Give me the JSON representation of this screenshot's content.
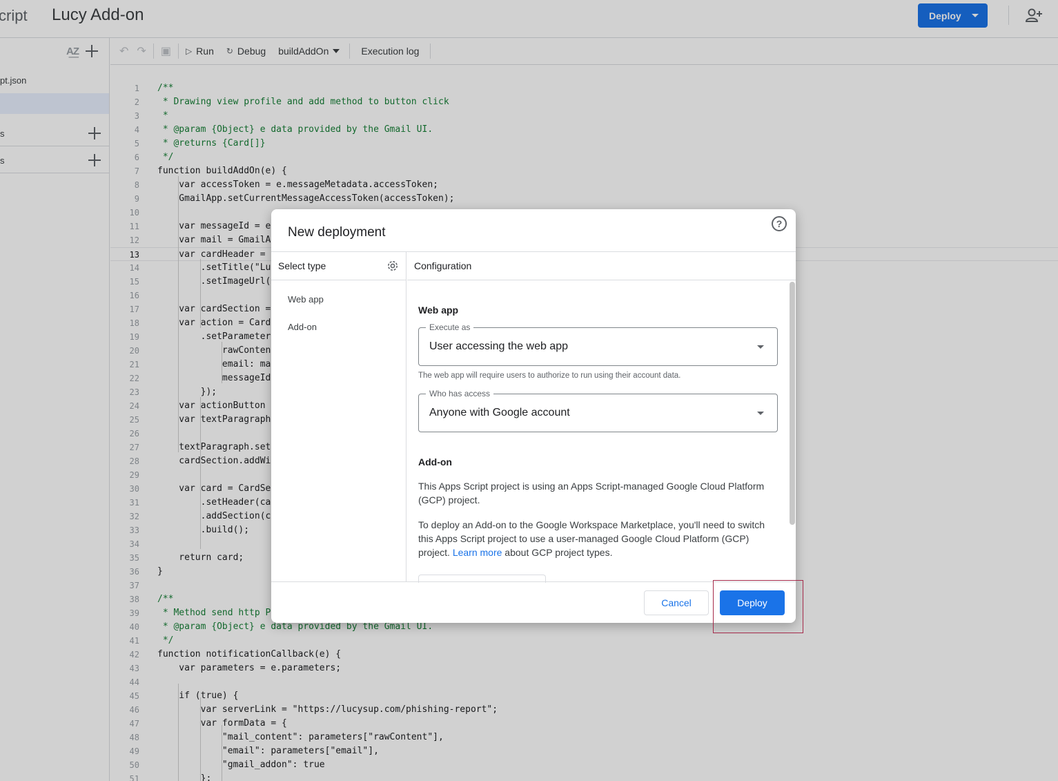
{
  "header": {
    "app_name": "cript",
    "project_title": "Lucy Add-on",
    "deploy_label": "Deploy"
  },
  "sidebar": {
    "files": [
      "pt.json",
      ""
    ],
    "sections": [
      {
        "label": "s"
      },
      {
        "label": "s"
      }
    ]
  },
  "toolbar": {
    "run_label": "Run",
    "debug_label": "Debug",
    "function_name": "buildAddOn",
    "execution_log_label": "Execution log"
  },
  "editor": {
    "current_line": 13,
    "lines": [
      "/**",
      " * Drawing view profile and add method to button click",
      " *",
      " * @param {Object} e data provided by the Gmail UI.",
      " * @returns {Card[]}",
      " */",
      "function buildAddOn(e) {",
      "    var accessToken = e.messageMetadata.accessToken;",
      "    GmailApp.setCurrentMessageAccessToken(accessToken);",
      "",
      "    var messageId = e",
      "    var mail = GmailA",
      "    var cardHeader = ",
      "        .setTitle(\"Lu",
      "        .setImageUrl(",
      "",
      "    var cardSection =",
      "    var action = Card",
      "        .setParameter",
      "            rawConten",
      "            email: ma",
      "            messageId",
      "        });",
      "    var actionButton ",
      "    var textParagraph",
      "",
      "    textParagraph.set",
      "    cardSection.addWi",
      "",
      "    var card = CardSe",
      "        .setHeader(ca",
      "        .addSection(c",
      "        .build();",
      "",
      "    return card;",
      "}",
      "",
      "/**",
      " * Method send http P",
      " * @param {Object} e data provided by the Gmail UI.",
      " */",
      "function notificationCallback(e) {",
      "    var parameters = e.parameters;",
      "",
      "    if (true) {",
      "        var serverLink = \"https://lucysup.com/phishing-report\";",
      "        var formData = {",
      "            \"mail_content\": parameters[\"rawContent\"],",
      "            \"email\": parameters[\"email\"],",
      "            \"gmail_addon\": true",
      "        };"
    ]
  },
  "dialog": {
    "title": "New deployment",
    "select_type_label": "Select type",
    "types": [
      "Web app",
      "Add-on"
    ],
    "configuration_label": "Configuration",
    "help_glyph": "?",
    "web_app": {
      "heading": "Web app",
      "execute_as_label": "Execute as",
      "execute_as_value": "User accessing the web app",
      "execute_hint": "The web app will require users to authorize to run using their account data.",
      "access_label": "Who has access",
      "access_value": "Anyone with Google account"
    },
    "add_on": {
      "heading": "Add-on",
      "para1": "This Apps Script project is using an Apps Script-managed Google Cloud Platform (GCP) project.",
      "para2_before": "To deploy an Add-on to the Google Workspace Marketplace, you'll need to switch this Apps Script project to use a user-managed Google Cloud Platform (GCP) project. ",
      "para2_link": "Learn more",
      "para2_after": " about GCP project types."
    },
    "cancel_label": "Cancel",
    "deploy_label": "Deploy"
  },
  "colors": {
    "accent": "#1a73e8",
    "highlight": "#a52a4a"
  }
}
